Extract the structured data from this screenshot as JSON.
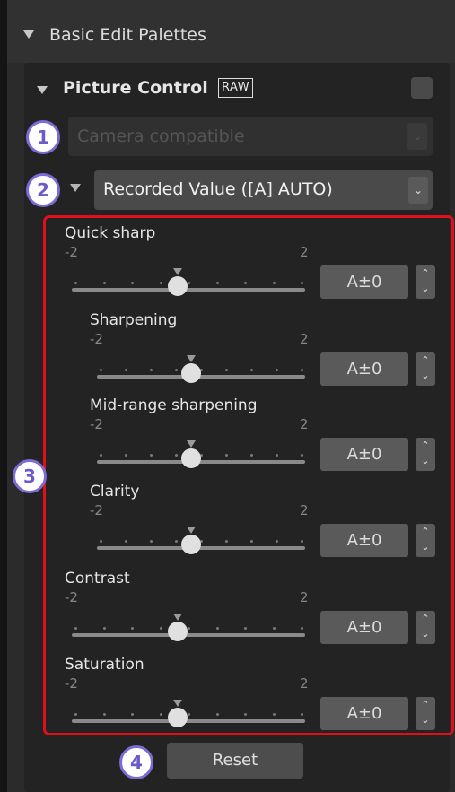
{
  "outer_section": {
    "title": "Basic Edit Palettes"
  },
  "picture_control": {
    "title": "Picture Control",
    "badge": "RAW",
    "mode_dropdown": {
      "value": "Camera compatible",
      "disabled": true
    },
    "recorded_dropdown": {
      "value": "Recorded Value ([A] AUTO)"
    }
  },
  "controls": [
    {
      "id": "quick-sharp",
      "label": "Quick sharp",
      "min": "-2",
      "max": "2",
      "value": "A±0"
    },
    {
      "id": "sharpening",
      "label": "Sharpening",
      "min": "-2",
      "max": "2",
      "value": "A±0"
    },
    {
      "id": "mid-range-sharpening",
      "label": "Mid-range sharpening",
      "min": "-2",
      "max": "2",
      "value": "A±0"
    },
    {
      "id": "clarity",
      "label": "Clarity",
      "min": "-2",
      "max": "2",
      "value": "A±0"
    },
    {
      "id": "contrast",
      "label": "Contrast",
      "min": "-2",
      "max": "2",
      "value": "A±0"
    },
    {
      "id": "saturation",
      "label": "Saturation",
      "min": "-2",
      "max": "2",
      "value": "A±0"
    }
  ],
  "reset_button": {
    "label": "Reset"
  },
  "callouts": [
    "1",
    "2",
    "3",
    "4"
  ],
  "colors": {
    "highlight_frame": "#e0101a",
    "callout_border": "#7a6bd6"
  },
  "icons": {
    "stepper": "up-down-stepper-icon",
    "dropdown": "chevron-down-icon"
  }
}
